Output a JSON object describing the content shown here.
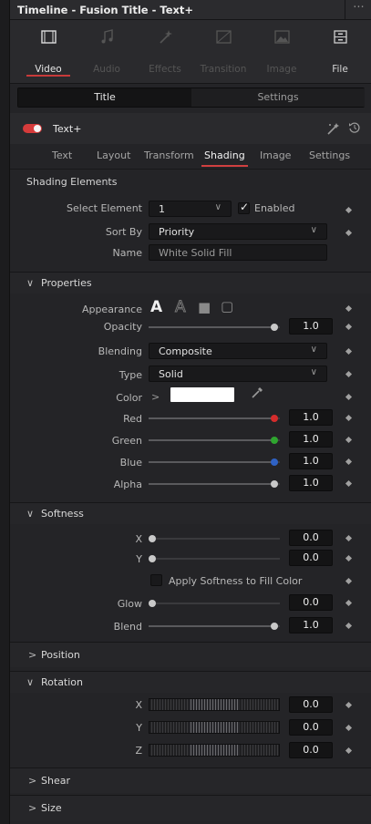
{
  "window": {
    "title": "Timeline - Fusion Title - Text+",
    "more": "···"
  },
  "tabs": [
    {
      "label": "Video",
      "icon": "film-icon",
      "state": "active"
    },
    {
      "label": "Audio",
      "icon": "music-note-icon",
      "state": "disabled"
    },
    {
      "label": "Effects",
      "icon": "magic-wand-icon",
      "state": "disabled"
    },
    {
      "label": "Transition",
      "icon": "transition-icon",
      "state": "disabled"
    },
    {
      "label": "Image",
      "icon": "image-icon",
      "state": "disabled"
    },
    {
      "label": "File",
      "icon": "file-cabinet-icon",
      "state": "normal"
    }
  ],
  "segment": {
    "title": "Title",
    "settings": "Settings"
  },
  "tool": {
    "name": "Text+",
    "enabled": true
  },
  "subtabs": [
    "Text",
    "Layout",
    "Transform",
    "Shading",
    "Image",
    "Settings"
  ],
  "active_subtab": "Shading",
  "shading_elements": {
    "heading": "Shading Elements",
    "select_element_label": "Select Element",
    "select_element_value": "1",
    "enabled_label": "Enabled",
    "enabled": true,
    "sort_by_label": "Sort By",
    "sort_by_value": "Priority",
    "name_label": "Name",
    "name_value": "White Solid Fill"
  },
  "properties": {
    "heading": "Properties",
    "appearance_label": "Appearance",
    "appearance_options": [
      "A",
      "A",
      "■",
      "▢"
    ],
    "opacity_label": "Opacity",
    "opacity": "1.0",
    "blending_label": "Blending",
    "blending": "Composite",
    "type_label": "Type",
    "type": "Solid",
    "color_label": "Color",
    "color_expand": ">",
    "color_hex": "#ffffff",
    "red_label": "Red",
    "red": "1.0",
    "green_label": "Green",
    "green": "1.0",
    "blue_label": "Blue",
    "blue": "1.0",
    "alpha_label": "Alpha",
    "alpha": "1.0",
    "colors": {
      "red": "#d42c2c",
      "green": "#2fa52f",
      "blue": "#2f62c4",
      "alpha": "#c9c9c9"
    }
  },
  "softness": {
    "heading": "Softness",
    "x_label": "X",
    "x": "0.0",
    "y_label": "Y",
    "y": "0.0",
    "apply_label": "Apply Softness to Fill Color",
    "apply": false,
    "glow_label": "Glow",
    "glow": "0.0",
    "blend_label": "Blend",
    "blend": "1.0"
  },
  "position": {
    "heading": "Position"
  },
  "rotation": {
    "heading": "Rotation",
    "x_label": "X",
    "x": "0.0",
    "y_label": "Y",
    "y": "0.0",
    "z_label": "Z",
    "z": "0.0"
  },
  "shear": {
    "heading": "Shear"
  },
  "size": {
    "heading": "Size"
  },
  "accent": "#d53b3b"
}
